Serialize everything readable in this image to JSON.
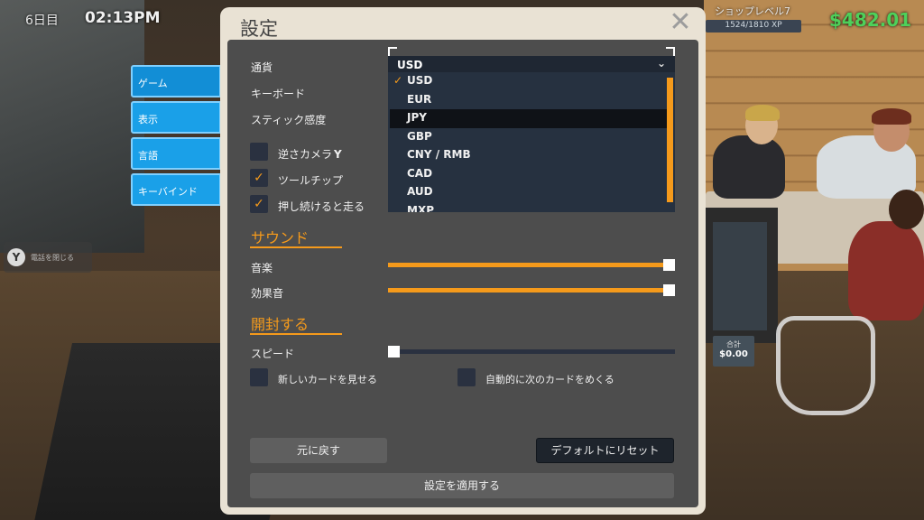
{
  "hud": {
    "day": "6日目",
    "time": "02:13PM",
    "shop_level": "ショップレベル7",
    "xp": "1524/1810 XP",
    "money": "$482.01"
  },
  "side_tabs": [
    "ゲーム",
    "表示",
    "言語",
    "キーバインド"
  ],
  "side_hint": {
    "button": "Y",
    "text": "電話を閉じる"
  },
  "background": {
    "price_label": "合計",
    "price_value": "$0.00"
  },
  "settings": {
    "title": "設定",
    "close_glyph": "✕",
    "labels": {
      "currency": "通貨",
      "keyboard": "キーボード",
      "stick_sensitivity": "スティック感度"
    },
    "checkboxes": [
      {
        "label": "逆さカメラ",
        "suffix": "Y",
        "checked": false
      },
      {
        "label": "ツールチップ",
        "checked": true
      },
      {
        "label": "押し続けると走る",
        "checked": true
      }
    ],
    "sound": {
      "title": "サウンド",
      "music_label": "音楽",
      "music_level": 1.0,
      "sfx_label": "効果音",
      "sfx_level": 1.0
    },
    "open": {
      "title": "開封する",
      "speed_label": "スピード",
      "speed_level": 0.0,
      "show_new_cards": "新しいカードを見せる",
      "auto_next_card": "自動的に次のカードをめくる"
    },
    "buttons": {
      "revert": "元に戻す",
      "reset_default": "デフォルトにリセット",
      "apply": "設定を適用する"
    },
    "currency_dropdown": {
      "selected": "USD",
      "options": [
        "USD",
        "EUR",
        "JPY",
        "GBP",
        "CNY / RMB",
        "CAD",
        "AUD",
        "MXP"
      ],
      "checked_index": 0,
      "highlighted_index": 2
    }
  },
  "colors": {
    "accent": "#f59a1b",
    "money": "#4ed05a",
    "tab": "#1aa0e8"
  }
}
